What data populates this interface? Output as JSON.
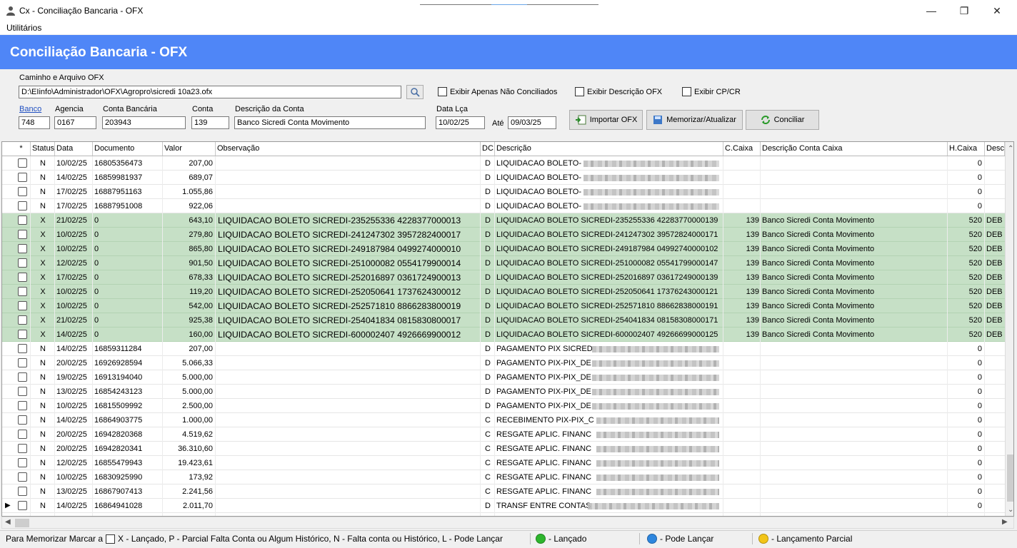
{
  "window": {
    "title": "Cx - Conciliação Bancaria - OFX"
  },
  "menu": {
    "items": [
      "Utilitários"
    ]
  },
  "banner": {
    "title": "Conciliação Bancaria - OFX"
  },
  "form": {
    "path_label": "Caminho e Arquivo OFX",
    "path_value": "D:\\EIinfo\\Administrador\\OFX\\Agropro\\sicredi 10a23.ofx",
    "chk_nao_conciliados": "Exibir Apenas Não Conciliados",
    "chk_descricao": "Exibir Descrição OFX",
    "chk_cpcr": "Exibir CP/CR",
    "banco_label": "Banco",
    "banco_value": "748",
    "agencia_label": "Agencia",
    "agencia_value": "0167",
    "conta_bancaria_label": "Conta Bancária",
    "conta_bancaria_value": "203943",
    "conta_label": "Conta",
    "conta_value": "139",
    "descricao_conta_label": "Descrição da Conta",
    "descricao_conta_value": "Banco Sicredi Conta Movimento",
    "data_label": "Data Lça",
    "data_ini": "10/02/25",
    "ate_label": "Até",
    "data_fim": "09/03/25",
    "btn_importar": "Importar OFX",
    "btn_memorizar": "Memorizar/Atualizar",
    "btn_conciliar": "Conciliar"
  },
  "grid": {
    "headers": [
      "*",
      "Status",
      "Data",
      "Documento",
      "Valor",
      "Observação",
      "DC",
      "Descrição",
      "C.Caixa",
      "Descrição Conta Caixa",
      "H.Caixa",
      "Desc"
    ],
    "rows": [
      {
        "status": "N",
        "data": "10/02/25",
        "doc": "16805356473",
        "valor": "207,00",
        "obs": "",
        "dc": "D",
        "desc": "LIQUIDACAO BOLETO-",
        "ccaixa": "",
        "desc_caixa": "",
        "hcaixa": "0",
        "desc2": "",
        "green": false
      },
      {
        "status": "N",
        "data": "14/02/25",
        "doc": "16859981937",
        "valor": "689,07",
        "obs": "",
        "dc": "D",
        "desc": "LIQUIDACAO BOLETO-",
        "ccaixa": "",
        "desc_caixa": "",
        "hcaixa": "0",
        "desc2": "",
        "green": false
      },
      {
        "status": "N",
        "data": "17/02/25",
        "doc": "16887951163",
        "valor": "1.055,86",
        "obs": "",
        "dc": "D",
        "desc": "LIQUIDACAO BOLETO-",
        "ccaixa": "",
        "desc_caixa": "",
        "hcaixa": "0",
        "desc2": "",
        "green": false
      },
      {
        "status": "N",
        "data": "17/02/25",
        "doc": "16887951008",
        "valor": "922,06",
        "obs": "",
        "dc": "D",
        "desc": "LIQUIDACAO BOLETO-",
        "ccaixa": "",
        "desc_caixa": "",
        "hcaixa": "0",
        "desc2": "",
        "green": false
      },
      {
        "status": "X",
        "data": "21/02/25",
        "doc": "0",
        "valor": "643,10",
        "obs": "LIQUIDACAO BOLETO SICREDI-235255336 4228377000013",
        "dc": "D",
        "desc": "LIQUIDACAO BOLETO SICREDI-235255336 42283770000139",
        "ccaixa": "139",
        "desc_caixa": "Banco Sicredi Conta Movimento",
        "hcaixa": "520",
        "desc2": "DEB",
        "green": true
      },
      {
        "status": "X",
        "data": "10/02/25",
        "doc": "0",
        "valor": "279,80",
        "obs": "LIQUIDACAO BOLETO SICREDI-241247302 3957282400017",
        "dc": "D",
        "desc": "LIQUIDACAO BOLETO SICREDI-241247302 39572824000171",
        "ccaixa": "139",
        "desc_caixa": "Banco Sicredi Conta Movimento",
        "hcaixa": "520",
        "desc2": "DEB",
        "green": true
      },
      {
        "status": "X",
        "data": "10/02/25",
        "doc": "0",
        "valor": "865,80",
        "obs": "LIQUIDACAO BOLETO SICREDI-249187984 0499274000010",
        "dc": "D",
        "desc": "LIQUIDACAO BOLETO SICREDI-249187984 04992740000102",
        "ccaixa": "139",
        "desc_caixa": "Banco Sicredi Conta Movimento",
        "hcaixa": "520",
        "desc2": "DEB",
        "green": true
      },
      {
        "status": "X",
        "data": "12/02/25",
        "doc": "0",
        "valor": "901,50",
        "obs": "LIQUIDACAO BOLETO SICREDI-251000082 0554179900014",
        "dc": "D",
        "desc": "LIQUIDACAO BOLETO SICREDI-251000082 05541799000147",
        "ccaixa": "139",
        "desc_caixa": "Banco Sicredi Conta Movimento",
        "hcaixa": "520",
        "desc2": "DEB",
        "green": true
      },
      {
        "status": "X",
        "data": "17/02/25",
        "doc": "0",
        "valor": "678,33",
        "obs": "LIQUIDACAO BOLETO SICREDI-252016897 0361724900013",
        "dc": "D",
        "desc": "LIQUIDACAO BOLETO SICREDI-252016897 03617249000139",
        "ccaixa": "139",
        "desc_caixa": "Banco Sicredi Conta Movimento",
        "hcaixa": "520",
        "desc2": "DEB",
        "green": true
      },
      {
        "status": "X",
        "data": "10/02/25",
        "doc": "0",
        "valor": "119,20",
        "obs": "LIQUIDACAO BOLETO SICREDI-252050641 1737624300012",
        "dc": "D",
        "desc": "LIQUIDACAO BOLETO SICREDI-252050641 17376243000121",
        "ccaixa": "139",
        "desc_caixa": "Banco Sicredi Conta Movimento",
        "hcaixa": "520",
        "desc2": "DEB",
        "green": true
      },
      {
        "status": "X",
        "data": "10/02/25",
        "doc": "0",
        "valor": "542,00",
        "obs": "LIQUIDACAO BOLETO SICREDI-252571810 8866283800019",
        "dc": "D",
        "desc": "LIQUIDACAO BOLETO SICREDI-252571810 88662838000191",
        "ccaixa": "139",
        "desc_caixa": "Banco Sicredi Conta Movimento",
        "hcaixa": "520",
        "desc2": "DEB",
        "green": true
      },
      {
        "status": "X",
        "data": "21/02/25",
        "doc": "0",
        "valor": "925,38",
        "obs": "LIQUIDACAO BOLETO SICREDI-254041834 0815830800017",
        "dc": "D",
        "desc": "LIQUIDACAO BOLETO SICREDI-254041834 08158308000171",
        "ccaixa": "139",
        "desc_caixa": "Banco Sicredi Conta Movimento",
        "hcaixa": "520",
        "desc2": "DEB",
        "green": true
      },
      {
        "status": "X",
        "data": "14/02/25",
        "doc": "0",
        "valor": "160,00",
        "obs": "LIQUIDACAO BOLETO SICREDI-600002407 4926669900012",
        "dc": "D",
        "desc": "LIQUIDACAO BOLETO SICREDI-600002407 49266699000125",
        "ccaixa": "139",
        "desc_caixa": "Banco Sicredi Conta Movimento",
        "hcaixa": "520",
        "desc2": "DEB",
        "green": true
      },
      {
        "status": "N",
        "data": "14/02/25",
        "doc": "16859311284",
        "valor": "207,00",
        "obs": "",
        "dc": "D",
        "desc": "PAGAMENTO PIX SICRED",
        "ccaixa": "",
        "desc_caixa": "",
        "hcaixa": "0",
        "desc2": "",
        "green": false
      },
      {
        "status": "N",
        "data": "20/02/25",
        "doc": "16926928594",
        "valor": "5.066,33",
        "obs": "",
        "dc": "D",
        "desc": "PAGAMENTO PIX-PIX_DE",
        "ccaixa": "",
        "desc_caixa": "",
        "hcaixa": "0",
        "desc2": "",
        "green": false
      },
      {
        "status": "N",
        "data": "19/02/25",
        "doc": "16913194040",
        "valor": "5.000,00",
        "obs": "",
        "dc": "D",
        "desc": "PAGAMENTO PIX-PIX_DE",
        "ccaixa": "",
        "desc_caixa": "",
        "hcaixa": "0",
        "desc2": "",
        "green": false
      },
      {
        "status": "N",
        "data": "13/02/25",
        "doc": "16854243123",
        "valor": "5.000,00",
        "obs": "",
        "dc": "D",
        "desc": "PAGAMENTO PIX-PIX_DE",
        "ccaixa": "",
        "desc_caixa": "",
        "hcaixa": "0",
        "desc2": "",
        "green": false
      },
      {
        "status": "N",
        "data": "10/02/25",
        "doc": "16815509992",
        "valor": "2.500,00",
        "obs": "",
        "dc": "D",
        "desc": "PAGAMENTO PIX-PIX_DE",
        "ccaixa": "",
        "desc_caixa": "",
        "hcaixa": "0",
        "desc2": "",
        "green": false
      },
      {
        "status": "N",
        "data": "14/02/25",
        "doc": "16864903775",
        "valor": "1.000,00",
        "obs": "",
        "dc": "C",
        "desc": "RECEBIMENTO PIX-PIX_C",
        "ccaixa": "",
        "desc_caixa": "",
        "hcaixa": "0",
        "desc2": "",
        "green": false
      },
      {
        "status": "N",
        "data": "20/02/25",
        "doc": "16942820368",
        "valor": "4.519,62",
        "obs": "",
        "dc": "C",
        "desc": "RESGATE APLIC. FINANC",
        "ccaixa": "",
        "desc_caixa": "",
        "hcaixa": "0",
        "desc2": "",
        "green": false
      },
      {
        "status": "N",
        "data": "20/02/25",
        "doc": "16942820341",
        "valor": "36.310,60",
        "obs": "",
        "dc": "C",
        "desc": "RESGATE APLIC. FINANC",
        "ccaixa": "",
        "desc_caixa": "",
        "hcaixa": "0",
        "desc2": "",
        "green": false
      },
      {
        "status": "N",
        "data": "12/02/25",
        "doc": "16855479943",
        "valor": "19.423,61",
        "obs": "",
        "dc": "C",
        "desc": "RESGATE APLIC. FINANC",
        "ccaixa": "",
        "desc_caixa": "",
        "hcaixa": "0",
        "desc2": "",
        "green": false
      },
      {
        "status": "N",
        "data": "10/02/25",
        "doc": "16830925990",
        "valor": "173,92",
        "obs": "",
        "dc": "C",
        "desc": "RESGATE APLIC. FINANC",
        "ccaixa": "",
        "desc_caixa": "",
        "hcaixa": "0",
        "desc2": "",
        "green": false
      },
      {
        "status": "N",
        "data": "13/02/25",
        "doc": "16867907413",
        "valor": "2.241,56",
        "obs": "",
        "dc": "C",
        "desc": "RESGATE APLIC. FINANC",
        "ccaixa": "",
        "desc_caixa": "",
        "hcaixa": "0",
        "desc2": "",
        "green": false
      },
      {
        "status": "N",
        "data": "14/02/25",
        "doc": "16864941028",
        "valor": "2.011,70",
        "obs": "",
        "dc": "D",
        "desc": "TRANSF ENTRE CONTAS",
        "ccaixa": "",
        "desc_caixa": "",
        "hcaixa": "0",
        "desc2": "",
        "green": false
      }
    ]
  },
  "status_bar": {
    "memorizar": "Para Memorizar Marcar a",
    "legend_text": "X - Lançado,  P - Parcial Falta Conta ou Algum Histórico,  N - Falta conta ou Histórico, L - Pode Lançar",
    "lancado": "- Lançado",
    "pode_lancar": "- Pode Lançar",
    "parcial": "- Lançamento Parcial",
    "colors": {
      "lancado": "#2db52d",
      "pode_lancar": "#2e86de",
      "parcial": "#f2c418"
    }
  },
  "colors": {
    "banner": "#4f86f7",
    "conciliado_row": "#c6e0c6"
  }
}
